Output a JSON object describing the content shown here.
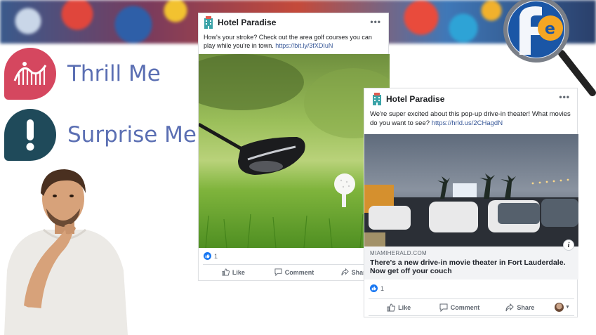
{
  "features": [
    {
      "label": "Thrill Me",
      "icon": "roller-coaster-icon",
      "color": "#d5475f"
    },
    {
      "label": "Surprise Me",
      "icon": "exclamation-icon",
      "color": "#1f4a5a"
    }
  ],
  "colors": {
    "feature_text": "#5b6fb3",
    "facebook_blue": "#1877f2",
    "link": "#385898"
  },
  "posts": [
    {
      "page_name": "Hotel Paradise",
      "text": "How's your stroke? Check out the area golf courses you can play while you're in town.",
      "link": "https://bit.ly/3fXDIuN",
      "photo": "golf-driver-and-ball-photo",
      "like_count": "1",
      "actions": {
        "like": "Like",
        "comment": "Comment",
        "share": "Share"
      }
    },
    {
      "page_name": "Hotel Paradise",
      "text": "We're super excited about this pop-up drive-in theater! What movies do you want to see?",
      "link": "https://hrld.us/2CHagdN",
      "photo": "drive-in-theater-night-photo",
      "preview_domain": "MIAMIHERALD.COM",
      "preview_title": "There's a new drive-in movie theater in Fort Lauderdale. Now get off your couch",
      "like_count": "1",
      "actions": {
        "like": "Like",
        "comment": "Comment",
        "share": "Share"
      }
    }
  ]
}
